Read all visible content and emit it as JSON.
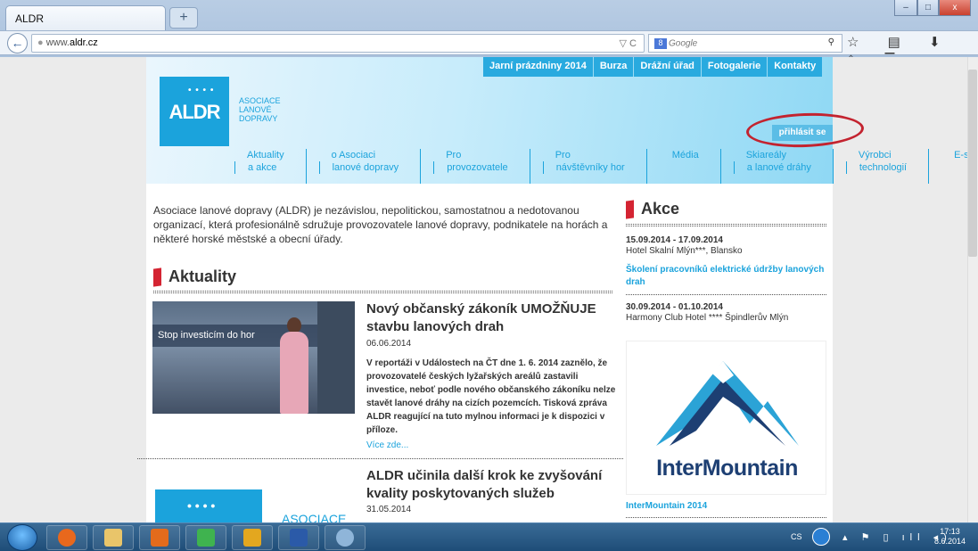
{
  "browser": {
    "tab_title": "ALDR",
    "new_tab": "+",
    "url_prefix": "www.",
    "url_domain": "aldr.cz",
    "search_engine": "8",
    "search_placeholder": "Google",
    "url_icons": "▽ C",
    "search_icon": "⚲",
    "toolbar_icons": "☆ ▤ ⬇ ⌂ ☰"
  },
  "site": {
    "top_nav": [
      "Jarní prázdniny 2014",
      "Burza",
      "Drážní úřad",
      "Fotogalerie",
      "Kontakty"
    ],
    "logo_text": "ALDR",
    "logo_dots": "• • • •",
    "logo_line1": "ASOCIACE",
    "logo_line2": "LANOVÉ",
    "logo_line3": "DOPRAVY",
    "login": "přihlásit se",
    "main_nav": [
      {
        "l1": "Aktuality",
        "l2": "a akce"
      },
      {
        "l1": "o Asociaci",
        "l2": "lanové dopravy"
      },
      {
        "l1": "Pro",
        "l2": "provozovatele"
      },
      {
        "l1": "Pro",
        "l2": "návštěvníky hor"
      },
      {
        "l1": "Média",
        "l2": ""
      },
      {
        "l1": "Skiareály",
        "l2": "a lanové dráhy"
      },
      {
        "l1": "Výrobci",
        "l2": "technologií"
      },
      {
        "l1": "E-shop",
        "l2": ""
      }
    ],
    "intro": "Asociace lanové dopravy (ALDR) je nezávislou, nepolitickou, samostatnou a nedotovanou organizací, která profesionálně sdružuje provozovatele lanové dopravy, podnikatele na horách a některé horské městské a obecní úřady.",
    "news_heading": "Aktuality",
    "article1": {
      "image_caption": "Stop investicím do hor",
      "title": "Nový občanský zákoník UMOŽŇUJE stavbu lanových drah",
      "date": "06.06.2014",
      "body": "V reportáži v Událostech na ČT dne 1. 6. 2014 zaznělo, že provozovatelé českých lyžařských areálů zastavili investice, neboť podle nového občanského zákoníku nelze stavět lanové dráhy na cizích pozemcích. Tisková zpráva ALDR reagující na tuto mylnou informaci je k dispozici v příloze.",
      "more": "Více zde..."
    },
    "article2": {
      "title": "ALDR učinila další krok ke zvyšování kvality poskytovaných služeb",
      "date": "31.05.2014",
      "logo_text": "ASOCIACE"
    },
    "events_heading": "Akce",
    "events": [
      {
        "date": "15.09.2014 - 17.09.2014",
        "place": "Hotel Skalní Mlýn***, Blansko",
        "title": "Školení pracovníků elektrické údržby lanových drah"
      },
      {
        "date": "30.09.2014 - 01.10.2014",
        "place": "Harmony Club Hotel **** Špindlerův Mlýn",
        "title": ""
      }
    ],
    "ad_brand": "InterMountain",
    "ad_link": "InterMountain 2014"
  },
  "taskbar": {
    "lang": "CS",
    "tray_icons": "▴ ⚑ ▯ ıll ◂)",
    "time": "17:13",
    "date": "8.6.2014"
  },
  "window_buttons": [
    "–",
    "□",
    "x"
  ]
}
